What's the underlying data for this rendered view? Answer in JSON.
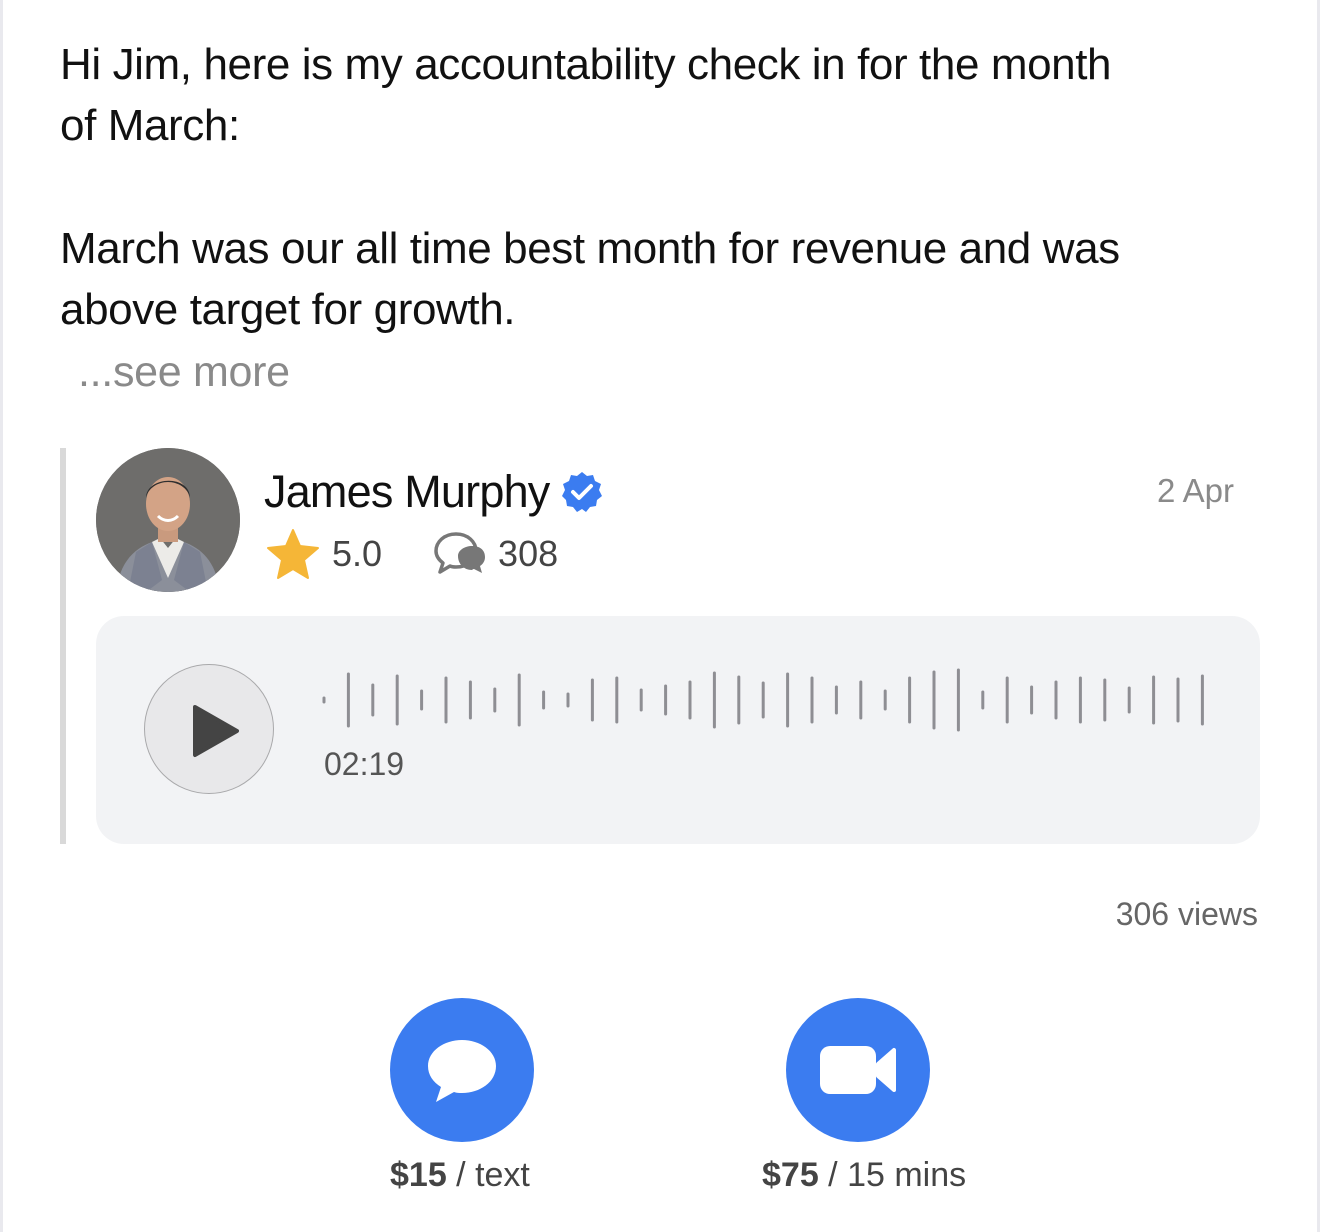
{
  "message": {
    "line1": "Hi Jim, here is my accountability check in for the month",
    "line2": "of March:",
    "line3": "March was our all time best month for revenue and was",
    "line4": "above target for growth.",
    "see_more": "...see more"
  },
  "reply": {
    "author": "James Murphy",
    "verified_icon": "verified-badge-icon",
    "date": "2 Apr",
    "rating": "5.0",
    "response_count": "308",
    "audio": {
      "duration": "02:19",
      "play_icon": "play-icon",
      "waveform_icon": "waveform-icon"
    }
  },
  "views": "306 views",
  "actions": {
    "text": {
      "icon": "chat-bubble-icon",
      "price": "$15",
      "unit": " / text"
    },
    "video": {
      "icon": "video-camera-icon",
      "price": "$75",
      "unit": " / 15 mins"
    }
  },
  "colors": {
    "accent": "#3b7cf0",
    "verified": "#3b7cf0",
    "star": "#f5b637",
    "card_bg": "#f2f3f5",
    "muted_text": "#8a8a8a"
  }
}
